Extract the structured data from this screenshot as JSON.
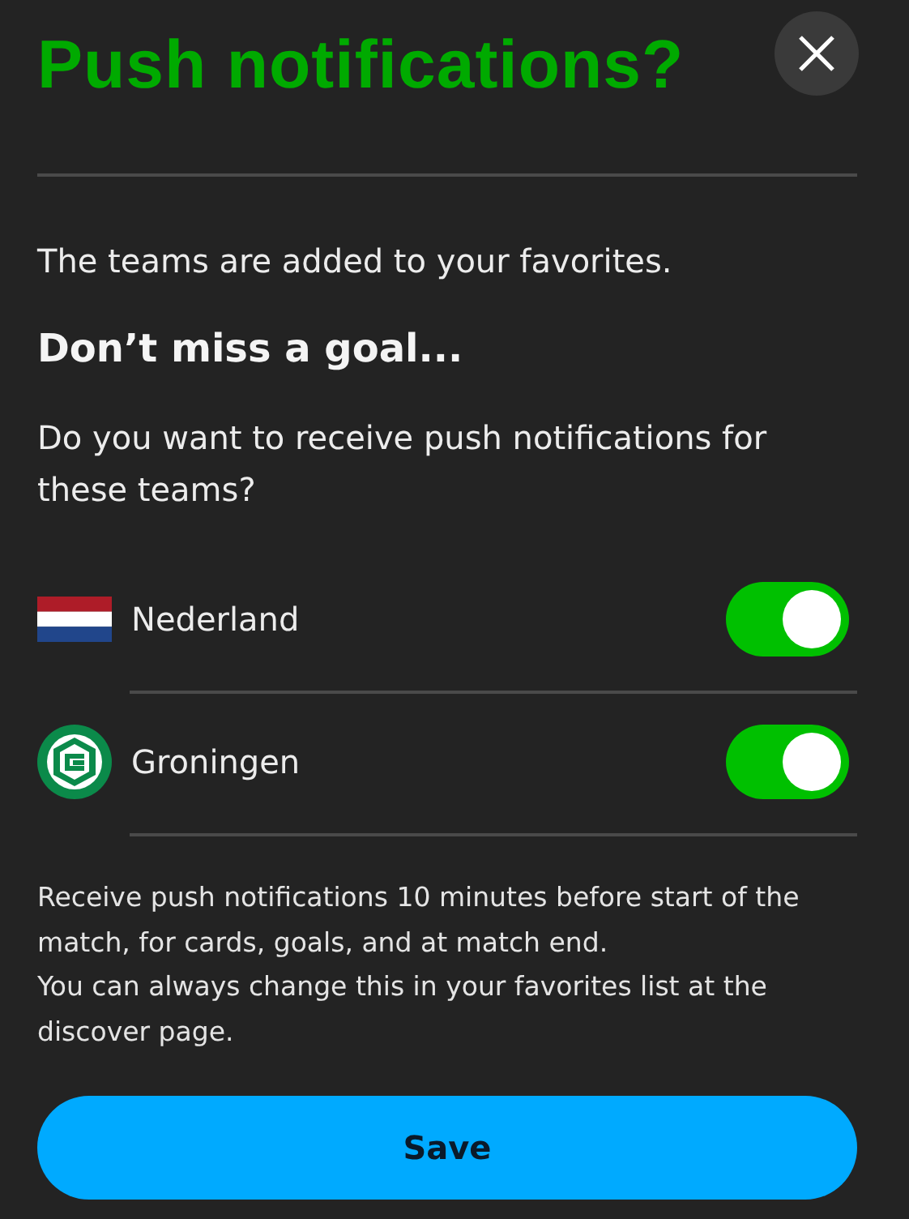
{
  "title": "Push notifications?",
  "intro": "The teams are added to your favorites.",
  "heading": "Don’t miss a goal...",
  "question": "Do you want to receive push notifications for these teams?",
  "teams": [
    {
      "name": "Nederland",
      "kind": "flag",
      "on": true
    },
    {
      "name": "Groningen",
      "kind": "crest",
      "on": true
    }
  ],
  "info": [
    "Receive push notifications 10 minutes before start of the match, for cards, goals, and at match end.",
    "You can always change this in your favorites list at the discover page."
  ],
  "save_button": "Save"
}
